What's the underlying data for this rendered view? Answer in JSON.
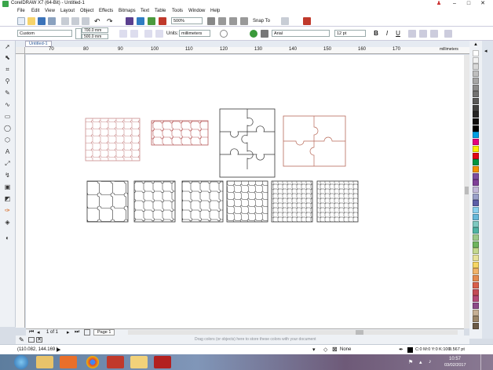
{
  "window": {
    "title": "CorelDRAW X7 (64-Bit) - Untitled-1",
    "controls": {
      "minimize": "–",
      "maximize": "□",
      "close": "✕"
    }
  },
  "menu": [
    "File",
    "Edit",
    "View",
    "Layout",
    "Object",
    "Effects",
    "Bitmaps",
    "Text",
    "Table",
    "Tools",
    "Window",
    "Help"
  ],
  "toolbar": {
    "zoom_value": "500%",
    "snap_to_label": "Snap To"
  },
  "property_bar": {
    "page_size_value": "Custom",
    "width_value": "700.0 mm",
    "height_value": "500.0 mm",
    "units_label": "Units:",
    "units_value": "millimeters",
    "font_value": "Arial",
    "font_size_value": "12 pt"
  },
  "document_tab": {
    "label": "Untitled-1"
  },
  "ruler": {
    "top_ticks": [
      "70",
      "80",
      "90",
      "100",
      "110",
      "120",
      "130",
      "140",
      "150",
      "160",
      "170"
    ],
    "units_label": "millimeters"
  },
  "pager": {
    "page_count": "1 of 1",
    "page_tab": "Page 1"
  },
  "hint_text": "Drag colors (or objects) here to store these colors with your document",
  "status": {
    "coordinates": "(110.082, 144.169 )",
    "fill_label": "None",
    "outline_color_label": "C:0 M:0 Y:0 K:100",
    "outline_width": "0.567 pt"
  },
  "tray": {
    "time": "10:57",
    "date": "03/02/2017"
  },
  "palette_colors": [
    "#ffffff",
    "#f2f2f2",
    "#d9d9d9",
    "#bfbfbf",
    "#a6a6a6",
    "#8c8c8c",
    "#737373",
    "#595959",
    "#404040",
    "#262626",
    "#0d0d0d",
    "#000000",
    "#00a0e3",
    "#e6007e",
    "#ffed00",
    "#e30613",
    "#009640",
    "#f39200",
    "#7c4d9e",
    "#7f3f98",
    "#c2b8d8",
    "#9aa0c9",
    "#5c5ea8",
    "#8ad0ee",
    "#65b7d9",
    "#7ec8c0",
    "#4fb3a4",
    "#9cc98a",
    "#6fb55f",
    "#c3d88e",
    "#e7e29a",
    "#f5d565",
    "#f1b36a",
    "#e58a4f",
    "#d95f4b",
    "#c44c57",
    "#b44a78",
    "#8c4a88",
    "#c6b095",
    "#9b8568",
    "#6b5a46"
  ],
  "colors": {
    "puzzle_red": "#c98a8a",
    "puzzle_dark": "#333333",
    "puzzle_brown": "#b86a5a",
    "accent_blue": "#2b5797"
  },
  "taskbar_apps": [
    "start",
    "explorer",
    "media-player",
    "chrome",
    "coreldraw",
    "folder",
    "acrobat"
  ]
}
